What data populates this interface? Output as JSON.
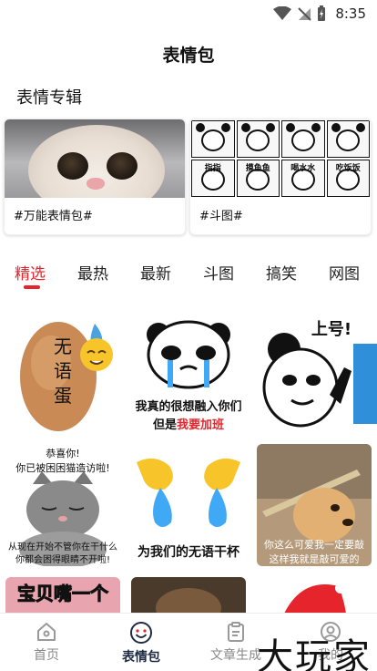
{
  "status_bar": {
    "time": "8:35"
  },
  "header": {
    "title": "表情包"
  },
  "albums_section": {
    "title": "表情专辑",
    "items": [
      {
        "label": "#万能表情包#"
      },
      {
        "label": "#斗图#",
        "captions": [
          "指指",
          "摸鱼鱼",
          "喝水水",
          "吃饭饭"
        ]
      }
    ]
  },
  "tabs": [
    {
      "label": "精选",
      "active": true
    },
    {
      "label": "最热"
    },
    {
      "label": "最新"
    },
    {
      "label": "斗图"
    },
    {
      "label": "搞笑"
    },
    {
      "label": "网图"
    }
  ],
  "memes": {
    "egg_text": "无语蛋",
    "panda_cry_line1": "我真的很想融入你们",
    "panda_cry_line2a": "但是",
    "panda_cry_line2b": "我要加班",
    "panda_shout": "上号!",
    "cat_top1": "恭喜你!",
    "cat_top2": "你已被困困猫造访啦!",
    "cat_bottom1": "从现在开始不管你在干什么",
    "cat_bottom2": "你都会困得眼睛不开啦!",
    "drops_text": "为我们的无语干杯",
    "doge_text1": "你这么可爱我一定要敲",
    "doge_text2": "这样我就是敲可爱的",
    "baby_text": "宝贝嘴一个"
  },
  "bottom_nav": [
    {
      "label": "首页"
    },
    {
      "label": "表情包",
      "active": true
    },
    {
      "label": "文章生成"
    },
    {
      "label": "我的"
    }
  ],
  "watermark": "大玩家",
  "colors": {
    "accent": "#e5242b",
    "nav_active": "#1f2a44",
    "nav_inactive": "#888888"
  }
}
